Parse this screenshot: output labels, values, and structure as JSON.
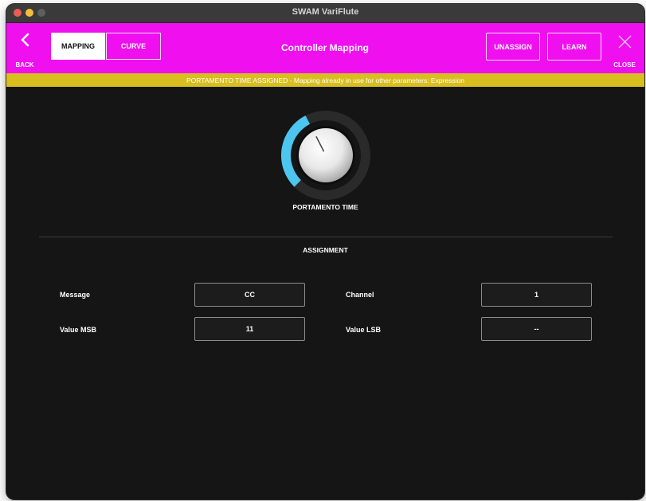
{
  "window": {
    "title": "SWAM VariFlute"
  },
  "header": {
    "back_label": "BACK",
    "close_label": "CLOSE",
    "title": "Controller Mapping",
    "tabs": [
      {
        "label": "MAPPING",
        "active": true
      },
      {
        "label": "CURVE",
        "active": false
      }
    ],
    "unassign_label": "UNASSIGN",
    "learn_label": "LEARN",
    "background_color": "#ef0fef"
  },
  "warning": {
    "text": "PORTAMENTO TIME ASSIGNED - Mapping already in use for other parameters: Expression",
    "color": "#d8be1e"
  },
  "knob": {
    "label": "PORTAMENTO TIME",
    "value_fraction": 0.4,
    "accent_color": "#4cc6ef"
  },
  "assignment": {
    "title": "ASSIGNMENT",
    "message_label": "Message",
    "message_value": "CC",
    "channel_label": "Channel",
    "channel_value": "1",
    "value_msb_label": "Value MSB",
    "value_msb_value": "11",
    "value_lsb_label": "Value LSB",
    "value_lsb_value": "--"
  },
  "icons": {
    "back": "chevron-left-icon",
    "close": "close-x-icon"
  }
}
